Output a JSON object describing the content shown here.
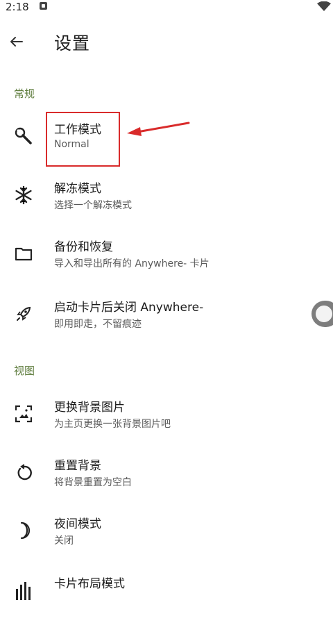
{
  "status_bar": {
    "time": "2:18"
  },
  "app_bar": {
    "title": "设置"
  },
  "sections": {
    "general": "常规",
    "view": "视图"
  },
  "rows": {
    "work_mode": {
      "title": "工作模式",
      "summary": "Normal",
      "icon": "wrench-icon"
    },
    "unfreeze_mode": {
      "title": "解冻模式",
      "summary": "选择一个解冻模式",
      "icon": "snowflake-icon"
    },
    "backup": {
      "title": "备份和恢复",
      "summary": "导入和导出所有的 Anywhere- 卡片",
      "icon": "folder-icon"
    },
    "close_after_launch": {
      "title": "启动卡片后关闭 Anywhere-",
      "summary": "即用即走，不留痕迹",
      "icon": "rocket-icon",
      "toggle_on": false
    },
    "change_background": {
      "title": "更换背景图片",
      "summary": "为主页更换一张背景图片吧",
      "icon": "image-frame-icon"
    },
    "reset_background": {
      "title": "重置背景",
      "summary": "将背景重置为空白",
      "icon": "reset-icon"
    },
    "night_mode": {
      "title": "夜间模式",
      "summary": "关闭",
      "icon": "moon-icon"
    },
    "card_layout": {
      "title": "卡片布局模式",
      "summary": "",
      "icon": "bar-chart-icon"
    }
  },
  "colors": {
    "section_header": "#5f7d3e",
    "highlight": "#d92b2b",
    "toggle_track": "#7d7d7d"
  }
}
